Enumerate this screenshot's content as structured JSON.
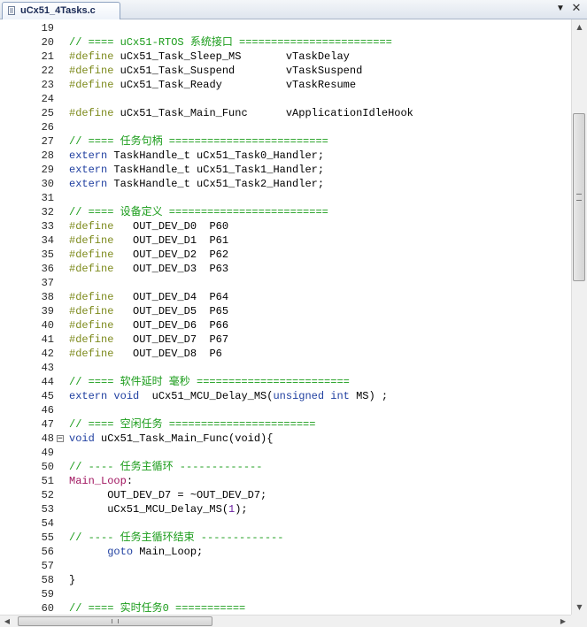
{
  "tab": {
    "title": "uCx51_4Tasks.c",
    "menu_glyph": "▼",
    "close_glyph": "✕"
  },
  "colors": {
    "comment": "#1a9c1a",
    "preprocessor": "#7d8a1c",
    "keyword": "#1f3fa0",
    "label": "#a0145f",
    "number": "#6a1fa0"
  },
  "lines": [
    {
      "n": "19",
      "parts": []
    },
    {
      "n": "20",
      "parts": [
        [
          "cmt",
          "// ==== uCx51-RTOS 系统接口 ========================"
        ]
      ]
    },
    {
      "n": "21",
      "parts": [
        [
          "pp",
          "#define"
        ],
        [
          "txt",
          " uCx51_Task_Sleep_MS       vTaskDelay"
        ]
      ]
    },
    {
      "n": "22",
      "parts": [
        [
          "pp",
          "#define"
        ],
        [
          "txt",
          " uCx51_Task_Suspend        vTaskSuspend"
        ]
      ]
    },
    {
      "n": "23",
      "parts": [
        [
          "pp",
          "#define"
        ],
        [
          "txt",
          " uCx51_Task_Ready          vTaskResume"
        ]
      ]
    },
    {
      "n": "24",
      "parts": []
    },
    {
      "n": "25",
      "parts": [
        [
          "pp",
          "#define"
        ],
        [
          "txt",
          " uCx51_Task_Main_Func      vApplicationIdleHook"
        ]
      ]
    },
    {
      "n": "26",
      "parts": []
    },
    {
      "n": "27",
      "parts": [
        [
          "cmt",
          "// ==== 任务句柄 ========================="
        ]
      ]
    },
    {
      "n": "28",
      "parts": [
        [
          "kw",
          "extern"
        ],
        [
          "txt",
          " TaskHandle_t uCx51_Task0_Handler;"
        ]
      ]
    },
    {
      "n": "29",
      "parts": [
        [
          "kw",
          "extern"
        ],
        [
          "txt",
          " TaskHandle_t uCx51_Task1_Handler;"
        ]
      ]
    },
    {
      "n": "30",
      "parts": [
        [
          "kw",
          "extern"
        ],
        [
          "txt",
          " TaskHandle_t uCx51_Task2_Handler;"
        ]
      ]
    },
    {
      "n": "31",
      "parts": []
    },
    {
      "n": "32",
      "parts": [
        [
          "cmt",
          "// ==== 设备定义 ========================="
        ]
      ]
    },
    {
      "n": "33",
      "parts": [
        [
          "pp",
          "#define"
        ],
        [
          "txt",
          "   OUT_DEV_D0  P60"
        ]
      ]
    },
    {
      "n": "34",
      "parts": [
        [
          "pp",
          "#define"
        ],
        [
          "txt",
          "   OUT_DEV_D1  P61"
        ]
      ]
    },
    {
      "n": "35",
      "parts": [
        [
          "pp",
          "#define"
        ],
        [
          "txt",
          "   OUT_DEV_D2  P62"
        ]
      ]
    },
    {
      "n": "36",
      "parts": [
        [
          "pp",
          "#define"
        ],
        [
          "txt",
          "   OUT_DEV_D3  P63"
        ]
      ]
    },
    {
      "n": "37",
      "parts": []
    },
    {
      "n": "38",
      "parts": [
        [
          "pp",
          "#define"
        ],
        [
          "txt",
          "   OUT_DEV_D4  P64"
        ]
      ]
    },
    {
      "n": "39",
      "parts": [
        [
          "pp",
          "#define"
        ],
        [
          "txt",
          "   OUT_DEV_D5  P65"
        ]
      ]
    },
    {
      "n": "40",
      "parts": [
        [
          "pp",
          "#define"
        ],
        [
          "txt",
          "   OUT_DEV_D6  P66"
        ]
      ]
    },
    {
      "n": "41",
      "parts": [
        [
          "pp",
          "#define"
        ],
        [
          "txt",
          "   OUT_DEV_D7  P67"
        ]
      ]
    },
    {
      "n": "42",
      "parts": [
        [
          "pp",
          "#define"
        ],
        [
          "txt",
          "   OUT_DEV_D8  P6"
        ]
      ]
    },
    {
      "n": "43",
      "parts": []
    },
    {
      "n": "44",
      "parts": [
        [
          "cmt",
          "// ==== 软件延时 毫秒 ========================"
        ]
      ]
    },
    {
      "n": "45",
      "parts": [
        [
          "kw",
          "extern"
        ],
        [
          "txt",
          " "
        ],
        [
          "kw",
          "void"
        ],
        [
          "txt",
          "  uCx51_MCU_Delay_MS("
        ],
        [
          "kw",
          "unsigned"
        ],
        [
          "txt",
          " "
        ],
        [
          "kw",
          "int"
        ],
        [
          "txt",
          " MS) ;"
        ]
      ]
    },
    {
      "n": "46",
      "parts": []
    },
    {
      "n": "47",
      "parts": [
        [
          "cmt",
          "// ==== 空闲任务 ======================="
        ]
      ]
    },
    {
      "n": "48",
      "fold": true,
      "parts": [
        [
          "kw",
          "void"
        ],
        [
          "txt",
          " uCx51_Task_Main_Func(void){"
        ]
      ]
    },
    {
      "n": "49",
      "parts": []
    },
    {
      "n": "50",
      "parts": [
        [
          "cmt",
          "// ---- 任务主循环 -------------"
        ]
      ]
    },
    {
      "n": "51",
      "parts": [
        [
          "lbl",
          "Main_Loop"
        ],
        [
          "txt",
          ":"
        ]
      ]
    },
    {
      "n": "52",
      "parts": [
        [
          "txt",
          "      OUT_DEV_D7 = ~OUT_DEV_D7;"
        ]
      ]
    },
    {
      "n": "53",
      "parts": [
        [
          "txt",
          "      uCx51_MCU_Delay_MS("
        ],
        [
          "num",
          "1"
        ],
        [
          "txt",
          ");"
        ]
      ]
    },
    {
      "n": "54",
      "parts": []
    },
    {
      "n": "55",
      "parts": [
        [
          "cmt",
          "// ---- 任务主循环结束 -------------"
        ]
      ]
    },
    {
      "n": "56",
      "parts": [
        [
          "txt",
          "      "
        ],
        [
          "kw",
          "goto"
        ],
        [
          "txt",
          " Main_Loop;"
        ]
      ]
    },
    {
      "n": "57",
      "parts": []
    },
    {
      "n": "58",
      "parts": [
        [
          "txt",
          "}"
        ]
      ]
    },
    {
      "n": "59",
      "parts": []
    },
    {
      "n": "60",
      "parts": [
        [
          "cmt",
          "// ==== 实时任务0 ==========="
        ]
      ]
    }
  ],
  "scrollbars": {
    "up": "▲",
    "down": "▼",
    "left": "◀",
    "right": "▶"
  }
}
